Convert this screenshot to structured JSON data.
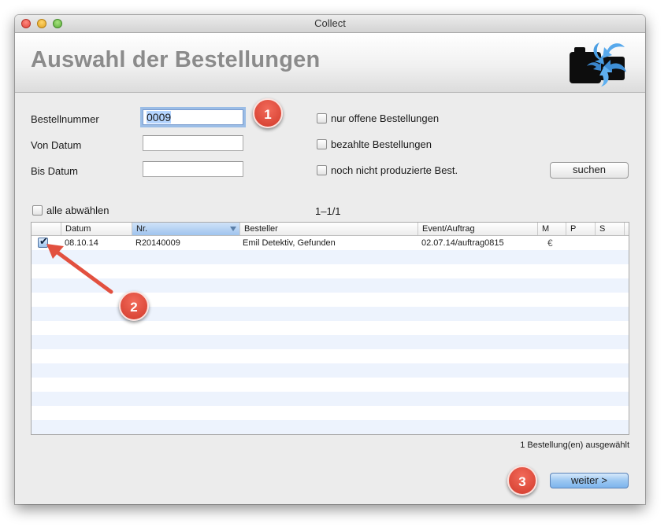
{
  "window": {
    "title": "Collect"
  },
  "header": {
    "title": "Auswahl der Bestellungen",
    "logo_icon": "collect-logo-icon"
  },
  "form": {
    "order_number_label": "Bestellnummer",
    "order_number_value": "0009",
    "from_date_label": "Von Datum",
    "from_date_value": "",
    "to_date_label": "Bis Datum",
    "to_date_value": "",
    "checkboxes": [
      {
        "label": "nur offene Bestellungen",
        "checked": false
      },
      {
        "label": "bezahlte Bestellungen",
        "checked": false
      },
      {
        "label": "noch nicht produzierte Best.",
        "checked": false
      }
    ],
    "search_button": "suchen"
  },
  "list": {
    "deselect_all_label": "alle abwählen",
    "pagination": "1–1/1",
    "columns": [
      "Datum",
      "Nr.",
      "Besteller",
      "Event/Auftrag",
      "M",
      "P",
      "S"
    ],
    "sorted_column": "Nr.",
    "rows": [
      {
        "checked": true,
        "datum": "08.10.14",
        "nr": "R20140009",
        "besteller": "Emil Detektiv, Gefunden",
        "event": "02.07.14/auftrag0815",
        "m": "€",
        "p": "",
        "s": ""
      }
    ]
  },
  "status": {
    "selected_text": "1 Bestellung(en) ausgewählt"
  },
  "footer": {
    "next_button": "weiter >"
  },
  "annotations": {
    "badge1": "1",
    "badge2": "2",
    "badge3": "3"
  },
  "colors": {
    "badge": "#d9412f",
    "selection": "#b5d5ff",
    "stripe": "#edf3fd",
    "primary_button": "#9cc7f2"
  }
}
